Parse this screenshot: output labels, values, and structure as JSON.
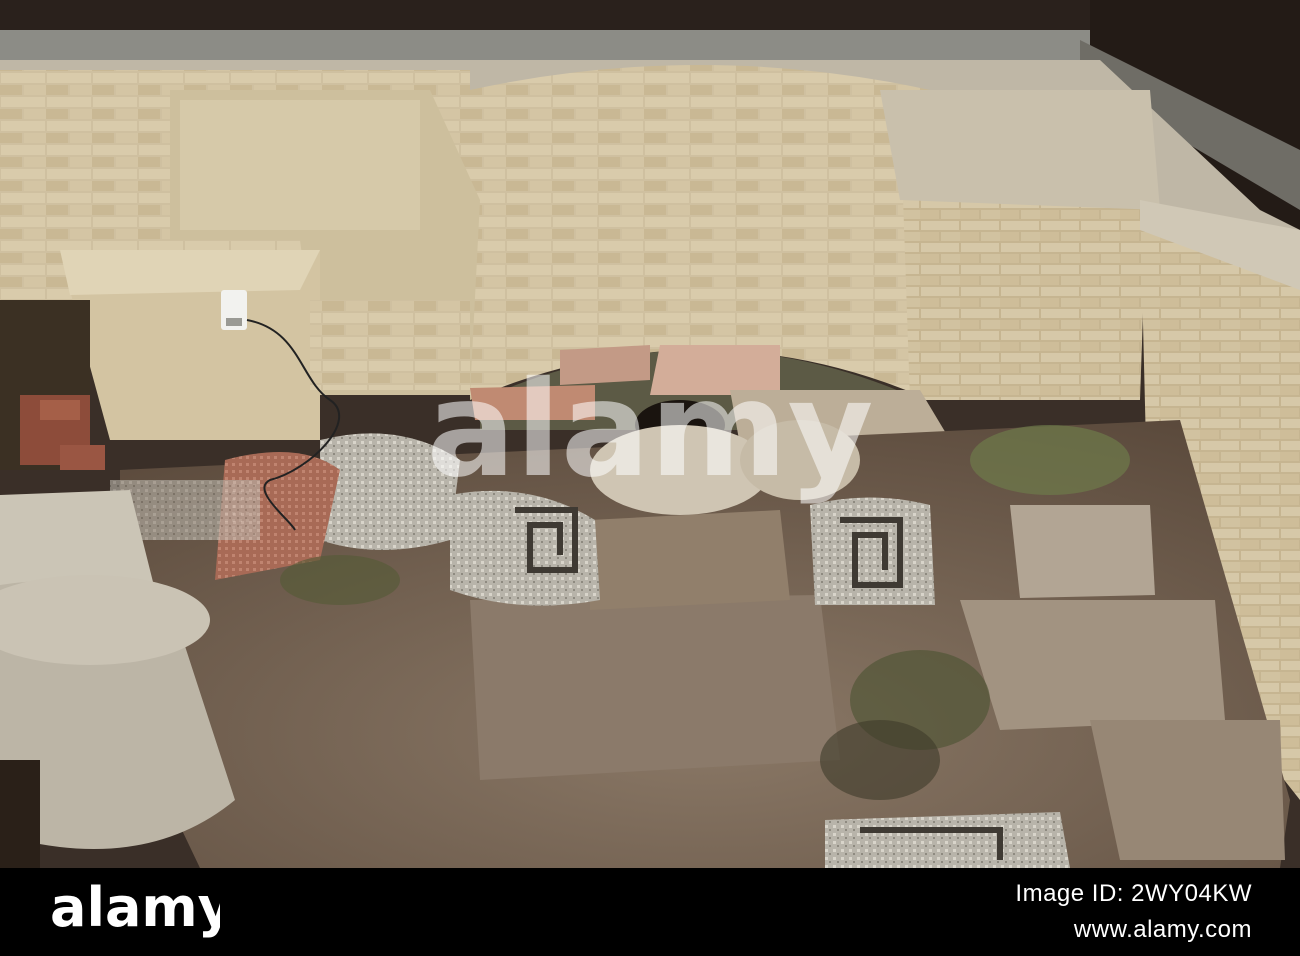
{
  "photo": {
    "subject": "Roman bath house ruins with curved apse wall, hypocaust stacks and mosaic floor fragments"
  },
  "watermark": {
    "text": "alamy"
  },
  "footer": {
    "brand": "alamy",
    "image_id": "Image ID: 2WY04KW",
    "url": "www.alamy.com"
  }
}
